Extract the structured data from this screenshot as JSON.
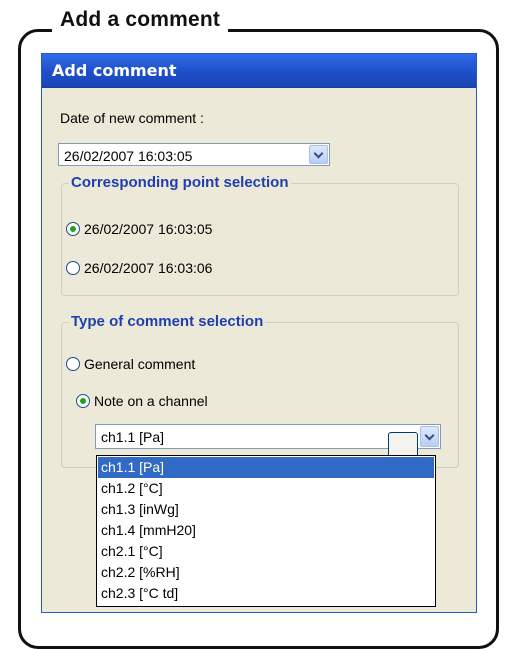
{
  "callout": {
    "title": "Add a comment"
  },
  "dialog": {
    "title": "Add comment",
    "date_label": "Date of new comment :",
    "date_value": "26/02/2007 16:03:05",
    "point_group": {
      "legend": "Corresponding point selection",
      "options": [
        {
          "label": "26/02/2007 16:03:05",
          "checked": true
        },
        {
          "label": "26/02/2007 16:03:06",
          "checked": false
        }
      ]
    },
    "type_group": {
      "legend": "Type of comment selection",
      "options": [
        {
          "label": "General comment",
          "checked": false
        },
        {
          "label": "Note on a channel",
          "checked": true
        }
      ],
      "channel_value": "ch1.1  [Pa]"
    },
    "channel_list": [
      {
        "label": "ch1.1  [Pa]",
        "selected": true
      },
      {
        "label": "ch1.2  [°C]",
        "selected": false
      },
      {
        "label": "ch1.3  [inWg]",
        "selected": false
      },
      {
        "label": "ch1.4  [mmH20]",
        "selected": false
      },
      {
        "label": "ch2.1  [°C]",
        "selected": false
      },
      {
        "label": "ch2.2  [%RH]",
        "selected": false
      },
      {
        "label": "ch2.3  [°C td]",
        "selected": false
      }
    ]
  }
}
